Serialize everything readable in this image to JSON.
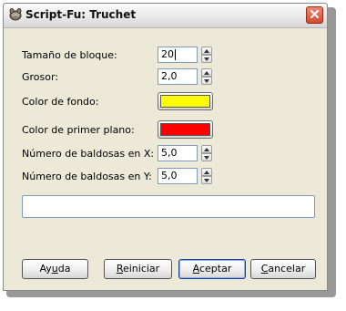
{
  "window": {
    "title": "Script-Fu: Truchet"
  },
  "fields": {
    "block_size": {
      "label": "Tamaño de bloque:",
      "value": "20"
    },
    "thickness": {
      "label": "Grosor:",
      "value": "2,0"
    },
    "bg_color": {
      "label": "Color de fondo:",
      "color": "#ffff00"
    },
    "fg_color": {
      "label": "Color de primer plano:",
      "color": "#ff0000"
    },
    "tiles_x": {
      "label": "Número de baldosas en X:",
      "value": "5,0"
    },
    "tiles_y": {
      "label": "Número de baldosas en Y:",
      "value": "5,0"
    }
  },
  "progress": {
    "text": "",
    "value": 0
  },
  "buttons": {
    "help": {
      "pre": "Ay",
      "mn": "u",
      "post": "da"
    },
    "reset": {
      "pre": "",
      "mn": "R",
      "post": "einiciar"
    },
    "ok": {
      "pre": "",
      "mn": "A",
      "post": "ceptar"
    },
    "cancel": {
      "pre": "",
      "mn": "C",
      "post": "ancelar"
    }
  },
  "icons": {
    "app": "gimp-icon",
    "close": "close-icon",
    "spin_up": "arrow-up-icon",
    "spin_down": "arrow-down-icon"
  },
  "colors": {
    "close_button": "#d24a2f",
    "input_border": "#7f9db9",
    "dialog_bg": "#ece9d8"
  }
}
